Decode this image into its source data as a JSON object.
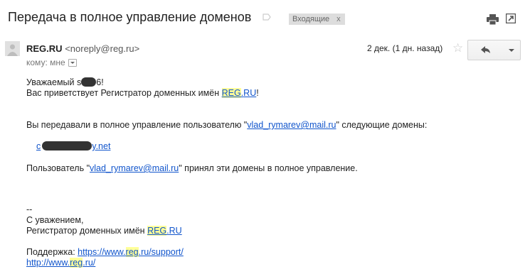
{
  "header": {
    "subject": "Передача в полное управление доменов",
    "label_chip": "Входящие",
    "chip_close": "x"
  },
  "message": {
    "sender_name": "REG.RU",
    "sender_email": "<noreply@reg.ru>",
    "to_me": "кому: мне",
    "date": "2 дек. (1 дн. назад)"
  },
  "body": {
    "greeting_prefix": "Уважаемый ",
    "greeting_start": "s",
    "greeting_end": "6!",
    "welcome_prefix": "Вас приветствует Регистратор доменных имён ",
    "reg_hl": "REG",
    "reg_dot": ".",
    "reg_ru": "RU",
    "welcome_suffix": "!",
    "transfer_prefix": "Вы передавали в полное управление пользователю \"",
    "transfer_email": "vlad_rymarev@mail.ru",
    "transfer_suffix": "\" следующие домены:",
    "domain_start": "c",
    "domain_end": "y.net",
    "accepted_prefix": "Пользователь \"",
    "accepted_email": "vlad_rymarev@mail.ru",
    "accepted_suffix": "\" принял эти домены в полное управление.",
    "sig_dash": "--",
    "sig_regards": "С уважением,",
    "sig_registrar_prefix": "Регистратор доменных имён ",
    "support_label": "Поддержка: ",
    "support_link_a": "https://www.",
    "support_link_hl": "reg",
    "support_link_b": ".ru/support/",
    "site_link_a": "http://www.",
    "site_link_hl": "reg",
    "site_link_b": ".ru/"
  },
  "colors": {
    "link": "#1155cc",
    "highlight": "#ffff99",
    "chip_bg": "#dddddd"
  },
  "icons": [
    "label-icon",
    "print-icon",
    "popout-icon",
    "avatar-icon",
    "star-icon",
    "reply-icon",
    "chevron-down-icon"
  ]
}
